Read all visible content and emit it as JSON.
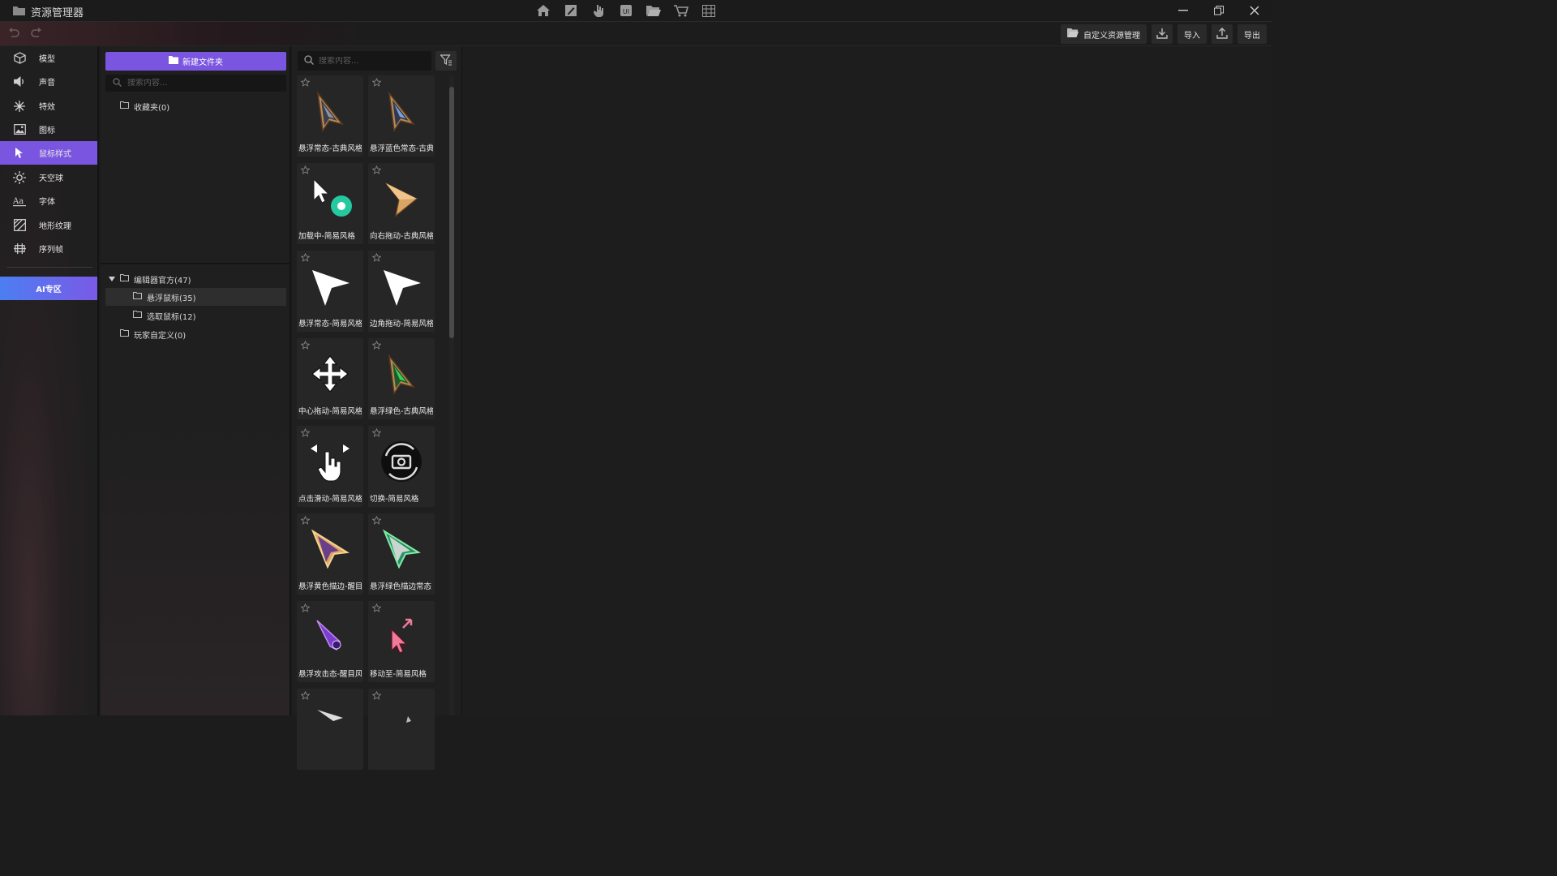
{
  "window": {
    "title": "资源管理器"
  },
  "toolbar": {
    "custom_manage_label": "自定义资源管理",
    "import_label": "导入",
    "export_label": "导出"
  },
  "sidebar": {
    "items": [
      {
        "label": "模型",
        "icon": "cube-icon"
      },
      {
        "label": "声音",
        "icon": "speaker-icon"
      },
      {
        "label": "特效",
        "icon": "sparkle-icon"
      },
      {
        "label": "图标",
        "icon": "image-icon"
      },
      {
        "label": "鼠标样式",
        "icon": "cursor-icon"
      },
      {
        "label": "天空球",
        "icon": "sun-icon"
      },
      {
        "label": "字体",
        "icon": "font-icon"
      },
      {
        "label": "地形纹理",
        "icon": "terrain-icon"
      },
      {
        "label": "序列帧",
        "icon": "frames-icon"
      }
    ],
    "active_label": "鼠标样式",
    "ai_label": "AI专区"
  },
  "folders": {
    "new_folder_label": "新建文件夹",
    "search_placeholder": "搜索内容...",
    "favorites": "收藏夹(0)",
    "tree": [
      {
        "label": "编辑器官方(47)",
        "expanded": true
      },
      {
        "label": "悬浮鼠标(35)",
        "selected": true
      },
      {
        "label": "选取鼠标(12)"
      },
      {
        "label": "玩家自定义(0)"
      }
    ]
  },
  "content": {
    "search_placeholder": "搜索内容...",
    "cards": [
      {
        "name": "悬浮常态-古典风格",
        "icon": "classic-gold-cursor-icon"
      },
      {
        "name": "悬浮蓝色常态-古典风格",
        "icon": "classic-blue-cursor-icon"
      },
      {
        "name": "加载中-简易风格",
        "icon": "loading-cursor-icon"
      },
      {
        "name": "向右拖动-古典风格",
        "icon": "drag-right-cursor-icon"
      },
      {
        "name": "悬浮常态-简易风格",
        "icon": "simple-cursor-icon"
      },
      {
        "name": "边角拖动-简易风格",
        "icon": "corner-drag-cursor-icon"
      },
      {
        "name": "中心拖动-简易风格",
        "icon": "move-arrows-icon"
      },
      {
        "name": "悬浮绿色-古典风格",
        "icon": "classic-green-cursor-icon"
      },
      {
        "name": "点击滑动-简易风格",
        "icon": "hand-swipe-icon"
      },
      {
        "name": "切换-简易风格",
        "icon": "camera-switch-icon"
      },
      {
        "name": "悬浮黄色描边-醒目风格",
        "icon": "yellow-outline-cursor-icon"
      },
      {
        "name": "悬浮绿色描边常态",
        "icon": "green-outline-cursor-icon"
      },
      {
        "name": "悬浮攻击态-醒目风格",
        "icon": "attack-cursor-icon"
      },
      {
        "name": "移动至-简易风格",
        "icon": "move-to-cursor-icon"
      },
      {
        "name": "",
        "icon": "partial-cursor-icon"
      },
      {
        "name": "",
        "icon": "partial-cursor-icon"
      }
    ]
  },
  "colors": {
    "accent": "#7a56e0",
    "ai_gradient_start": "#4c7ef2",
    "ai_gradient_end": "#7a5ae6"
  }
}
